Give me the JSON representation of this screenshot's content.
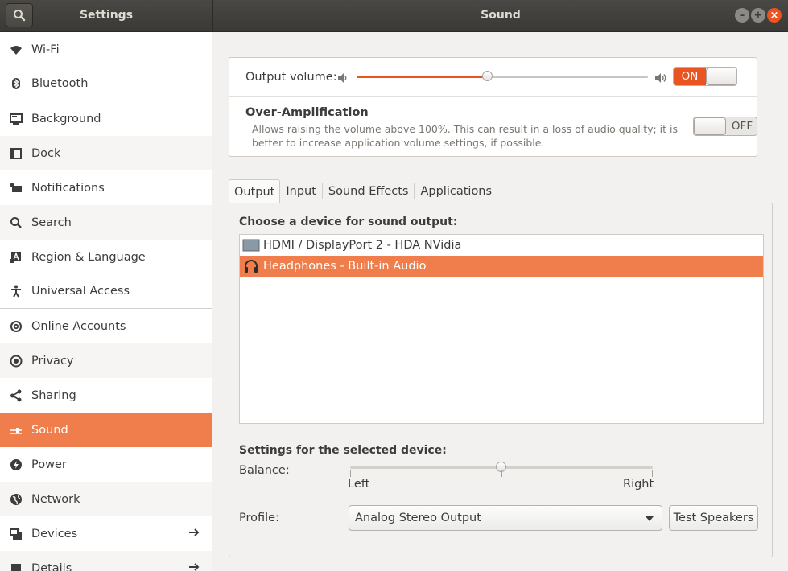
{
  "header": {
    "app_title": "Settings",
    "panel_title": "Sound"
  },
  "sidebar": {
    "items": [
      {
        "label": "Wi-Fi",
        "icon": "wifi-icon"
      },
      {
        "label": "Bluetooth",
        "icon": "bluetooth-icon"
      },
      {
        "label": "Background",
        "icon": "background-icon"
      },
      {
        "label": "Dock",
        "icon": "dock-icon"
      },
      {
        "label": "Notifications",
        "icon": "notifications-icon"
      },
      {
        "label": "Search",
        "icon": "search-icon"
      },
      {
        "label": "Region & Language",
        "icon": "region-language-icon"
      },
      {
        "label": "Universal Access",
        "icon": "universal-access-icon"
      },
      {
        "label": "Online Accounts",
        "icon": "online-accounts-icon"
      },
      {
        "label": "Privacy",
        "icon": "privacy-icon"
      },
      {
        "label": "Sharing",
        "icon": "sharing-icon"
      },
      {
        "label": "Sound",
        "icon": "sound-icon",
        "selected": true
      },
      {
        "label": "Power",
        "icon": "power-icon"
      },
      {
        "label": "Network",
        "icon": "network-icon"
      },
      {
        "label": "Devices",
        "icon": "devices-icon"
      },
      {
        "label": "Details",
        "icon": "details-icon"
      }
    ]
  },
  "output_volume": {
    "label": "Output volume:",
    "level_fraction": 0.45,
    "switch_label": "ON"
  },
  "over_amplification": {
    "title": "Over-Amplification",
    "description": "Allows raising the volume above 100%. This can result in a loss of audio quality; it is better to increase application volume settings, if possible.",
    "switch_label": "OFF"
  },
  "tabs": [
    "Output",
    "Input",
    "Sound Effects",
    "Applications"
  ],
  "output_tab": {
    "heading": "Choose a device for sound output:",
    "devices": [
      {
        "label": "HDMI / DisplayPort 2 - HDA NVidia",
        "icon": "monitor-icon"
      },
      {
        "label": "Headphones - Built-in Audio",
        "icon": "headphones-icon",
        "selected": true
      }
    ],
    "selected_heading": "Settings for the selected device:",
    "balance_label": "Balance:",
    "balance_left": "Left",
    "balance_right": "Right",
    "balance_fraction": 0.5,
    "profile_label": "Profile:",
    "profile_value": "Analog Stereo Output",
    "test_button": "Test Speakers"
  },
  "colors": {
    "accent": "#e95420",
    "selection": "#ef7e4c",
    "headerbar": "#3e3d39"
  }
}
